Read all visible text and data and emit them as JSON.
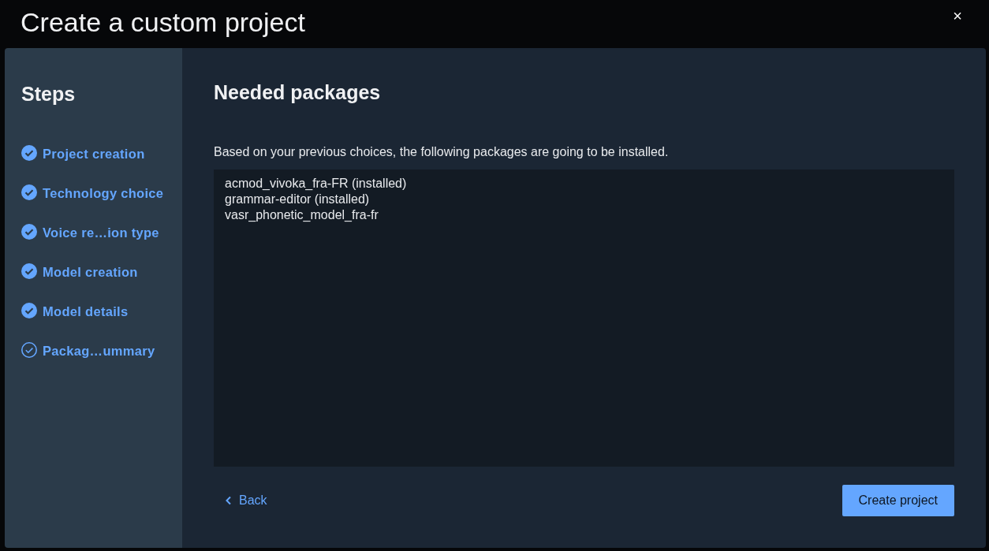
{
  "window": {
    "title": "Create a custom project",
    "close": "×"
  },
  "sidebar": {
    "title": "Steps",
    "steps": [
      {
        "label": "Project creation",
        "completed": true
      },
      {
        "label": "Technology choice",
        "completed": true
      },
      {
        "label": "Voice re…ion type",
        "completed": true
      },
      {
        "label": "Model creation",
        "completed": true
      },
      {
        "label": "Model details",
        "completed": true
      },
      {
        "label": "Packag…ummary",
        "completed": false
      }
    ]
  },
  "content": {
    "title": "Needed packages",
    "description": "Based on your previous choices, the following packages are going to be installed.",
    "packages": [
      "acmod_vivoka_fra-FR (installed)",
      "grammar-editor (installed)",
      "vasr_phonetic_model_fra-fr"
    ]
  },
  "footer": {
    "back": "Back",
    "create": "Create project"
  }
}
